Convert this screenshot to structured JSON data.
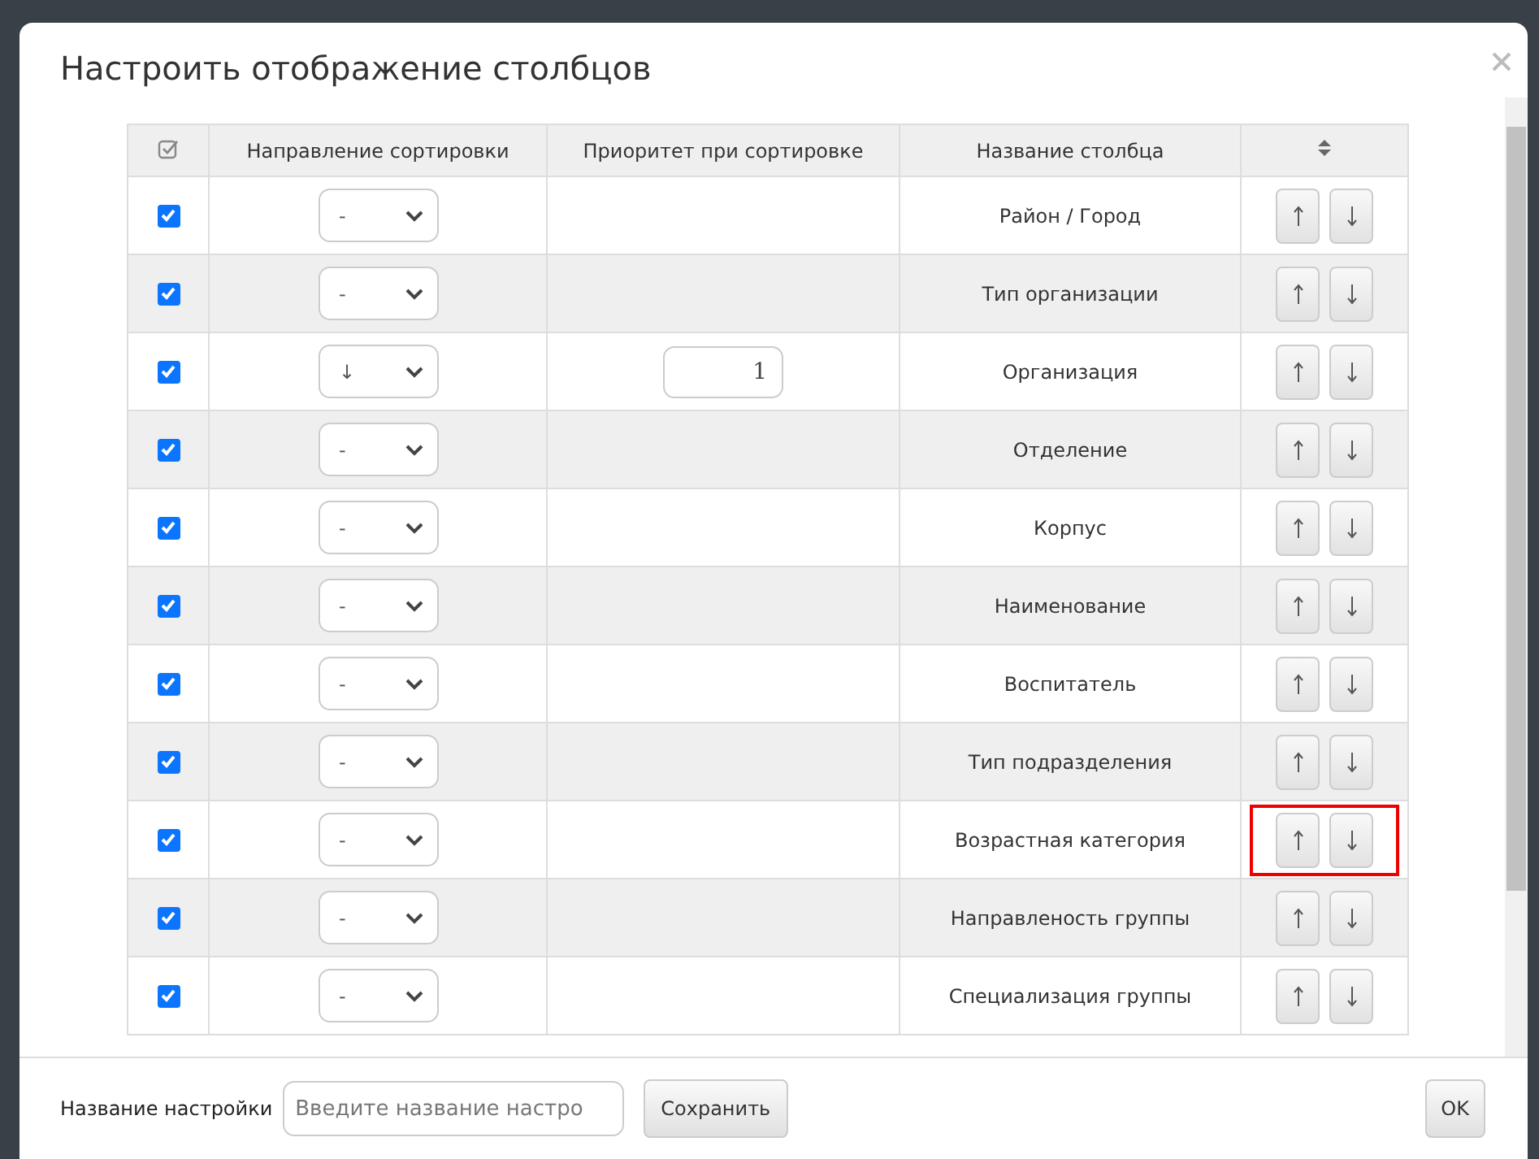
{
  "dialog": {
    "title": "Настроить отображение столбцов"
  },
  "table": {
    "columns": [
      "Направление сортировки",
      "Приоритет при сортировке",
      "Название столбца"
    ],
    "rows": [
      {
        "checked": true,
        "direction": "-",
        "name": "Район / Город",
        "highlighted": false
      },
      {
        "checked": true,
        "direction": "-",
        "name": "Тип организации",
        "highlighted": false
      },
      {
        "checked": true,
        "direction": "↓",
        "priority": "1",
        "name": "Организация",
        "highlighted": false
      },
      {
        "checked": true,
        "direction": "-",
        "name": "Отделение",
        "highlighted": false
      },
      {
        "checked": true,
        "direction": "-",
        "name": "Корпус",
        "highlighted": false
      },
      {
        "checked": true,
        "direction": "-",
        "name": "Наименование",
        "highlighted": false
      },
      {
        "checked": true,
        "direction": "-",
        "name": "Воспитатель",
        "highlighted": false
      },
      {
        "checked": true,
        "direction": "-",
        "name": "Тип подразделения",
        "highlighted": false
      },
      {
        "checked": true,
        "direction": "-",
        "name": "Возрастная категория",
        "highlighted": true
      },
      {
        "checked": true,
        "direction": "-",
        "name": "Направленость группы",
        "highlighted": false
      },
      {
        "checked": true,
        "direction": "-",
        "name": "Специализация группы",
        "highlighted": false
      }
    ]
  },
  "footer": {
    "label": "Название настройки",
    "placeholder": "Введите название настро",
    "save": "Сохранить",
    "ok": "OK"
  }
}
